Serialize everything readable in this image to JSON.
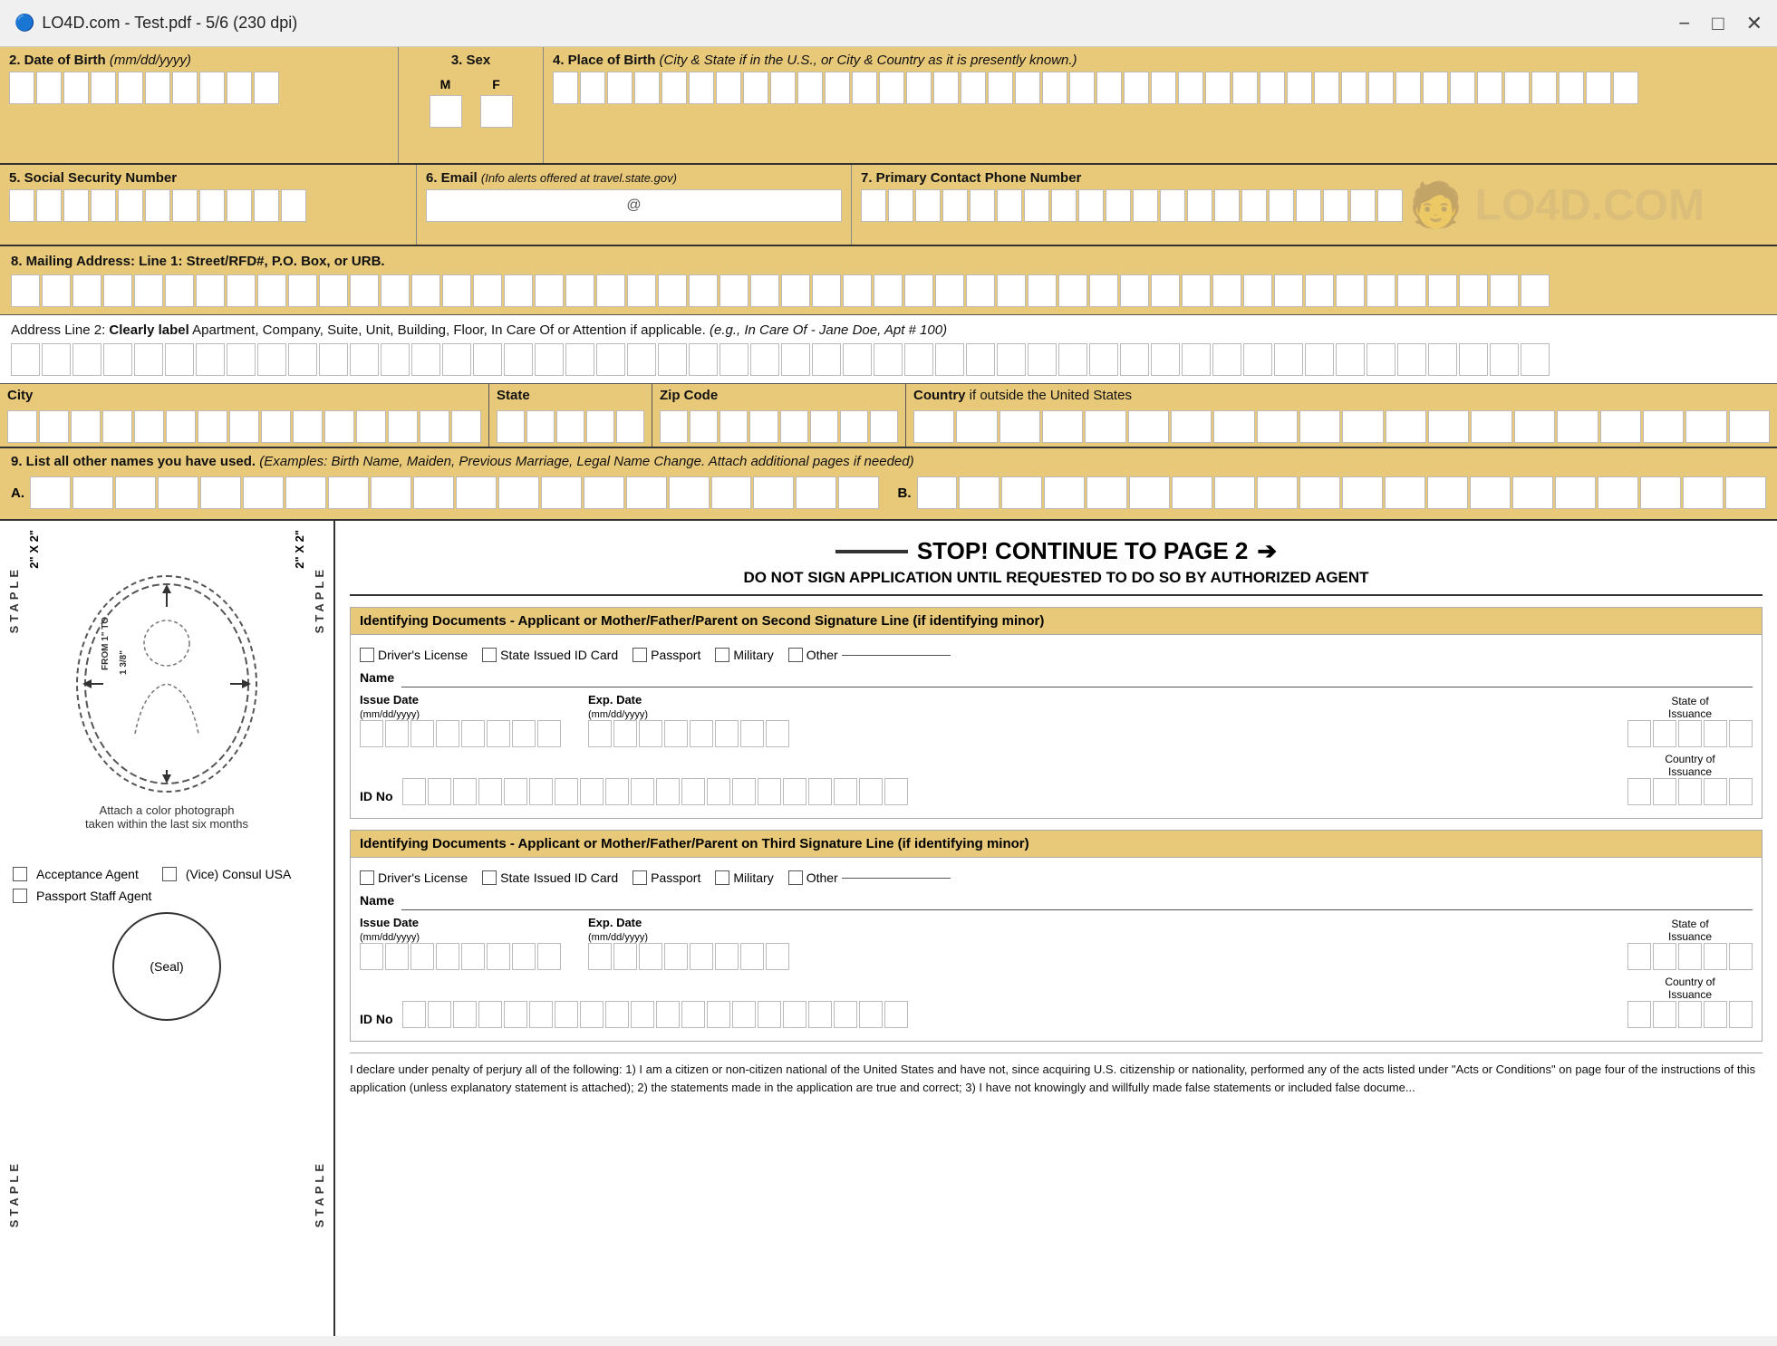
{
  "window": {
    "title": "LO4D.com - Test.pdf - 5/6 (230 dpi)",
    "icon": "🔵"
  },
  "form": {
    "field2_label": "2.  Date of Birth",
    "field2_format": "(mm/dd/yyyy)",
    "field3_label": "3.  Sex",
    "field3_m": "M",
    "field3_f": "F",
    "field4_label": "4.  Place of Birth",
    "field4_desc": "(City & State if in the U.S., or City & Country as it is presently known.)",
    "field5_label": "5.  Social Security Number",
    "field6_label": "6.  Email",
    "field6_desc": "(Info alerts offered at travel.state.gov)",
    "field6_at": "@",
    "field7_label": "7.  Primary Contact Phone Number",
    "field8_label": "8.  Mailing Address:",
    "field8_desc": "Line 1: Street/RFD#, P.O. Box, or URB.",
    "field8_addr2_label": "Address Line 2:",
    "field8_addr2_desc": "Clearly label",
    "field8_addr2_full": "Apartment, Company, Suite, Unit, Building, Floor, In Care Of or Attention if applicable.",
    "field8_addr2_example": "(e.g., In Care Of - Jane Doe, Apt # 100)",
    "city_label": "City",
    "state_label": "State",
    "zip_label": "Zip Code",
    "country_label": "Country",
    "country_desc": "if outside the United States",
    "field9_label": "9.  List all other names you have used.",
    "field9_desc": "(Examples: Birth Name, Maiden, Previous Marriage, Legal Name Change.  Attach additional  pages if needed)",
    "field9_a": "A.",
    "field9_b": "B.",
    "stop_title": "STOP! CONTINUE TO PAGE 2",
    "stop_subtitle": "DO NOT SIGN APPLICATION UNTIL REQUESTED TO DO SO BY AUTHORIZED AGENT",
    "id_docs1_header": "Identifying Documents - Applicant or Mother/Father/Parent on Second Signature Line (if identifying minor)",
    "id_docs2_header": "Identifying Documents - Applicant or Mother/Father/Parent on Third Signature Line (if identifying minor)",
    "drivers_license": "Driver's License",
    "state_id": "State Issued ID Card",
    "passport": "Passport",
    "military": "Military",
    "other": "Other",
    "name_label": "Name",
    "issue_date_label": "Issue Date",
    "issue_date_format": "(mm/dd/yyyy)",
    "exp_date_label": "Exp. Date",
    "exp_date_format": "(mm/dd/yyyy)",
    "state_issuance_label": "State of\nIssuance",
    "id_no_label": "ID No",
    "country_issuance_label": "Country of\nIssuance",
    "staple_label": "STAPLE",
    "two_by_two": "2\" X 2\"",
    "photo_caption": "Attach a color photograph\ntaken within the last six months",
    "from_label": "FROM 1\" TO\n1 3/8\"",
    "acceptance_agent": "Acceptance Agent",
    "vice_consul": "(Vice) Consul USA",
    "passport_staff": "Passport Staff Agent",
    "seal_label": "(Seal)",
    "declaration": "I declare under penalty of perjury all of the following: 1) I am a citizen or non-citizen national of the United States and have not, since acquiring U.S. citizenship or nationality, performed any of the acts listed under \"Acts or Conditions\" on page four of the instructions of this application (unless explanatory statement is attached); 2) the statements made in the application are true and correct; 3) I have not knowingly and willfully made false statements or included false docume..."
  }
}
